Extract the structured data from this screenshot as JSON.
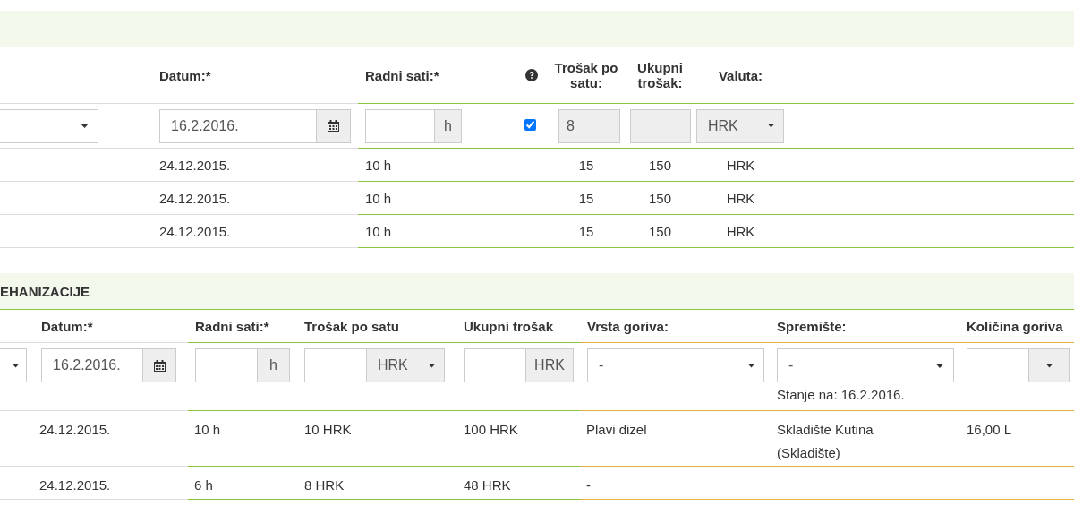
{
  "labor": {
    "headers": {
      "date": "Datum:*",
      "hours": "Radni sati:*",
      "cost": "Trošak po satu:",
      "total": "Ukupni trošak:",
      "currency": "Valuta:"
    },
    "form": {
      "date": {
        "value": "16.2.2016."
      },
      "hours": {
        "unit": "h",
        "disabled": false
      },
      "fixed_rate": {
        "checked": true
      },
      "cost": {
        "value": "8",
        "disabled": true
      },
      "total": {
        "disabled": true
      },
      "currency": {
        "value": "HRK",
        "disabled": true
      }
    },
    "rows": [
      {
        "date": "24.12.2015.",
        "hours": "10 h",
        "cost": "15",
        "total": "150",
        "currency": "HRK"
      },
      {
        "date": "24.12.2015.",
        "hours": "10 h",
        "cost": "15",
        "total": "150",
        "currency": "HRK"
      },
      {
        "date": "24.12.2015.",
        "hours": "10 h",
        "cost": "15",
        "total": "150",
        "currency": "HRK"
      }
    ]
  },
  "machinery": {
    "title": "EHANIZACIJE",
    "headers": {
      "date": "Datum:*",
      "hours": "Radni sati:*",
      "cost": "Trošak po satu",
      "total": "Ukupni trošak",
      "fuel": "Vrsta goriva:",
      "storage": "Spremište:",
      "quantity": "Količina goriva"
    },
    "form": {
      "date": {
        "value": "16.2.2016."
      },
      "hours": {
        "unit": "h"
      },
      "cost": {
        "currency": "HRK"
      },
      "total": {
        "unit": "HRK"
      },
      "fuel": {
        "value": "-"
      },
      "storage": {
        "value": "-",
        "note": "Stanje na: 16.2.2016."
      }
    },
    "rows": [
      {
        "date": "24.12.2015.",
        "hours": "10 h",
        "cost": "10 HRK",
        "total": "100 HRK",
        "fuel": "Plavi dizel",
        "storage": "Skladište Kutina (Skladište)",
        "quantity": "16,00 L"
      },
      {
        "date": "24.12.2015.",
        "hours": "6 h",
        "cost": "8 HRK",
        "total": "48 HRK",
        "fuel": "-"
      }
    ]
  }
}
